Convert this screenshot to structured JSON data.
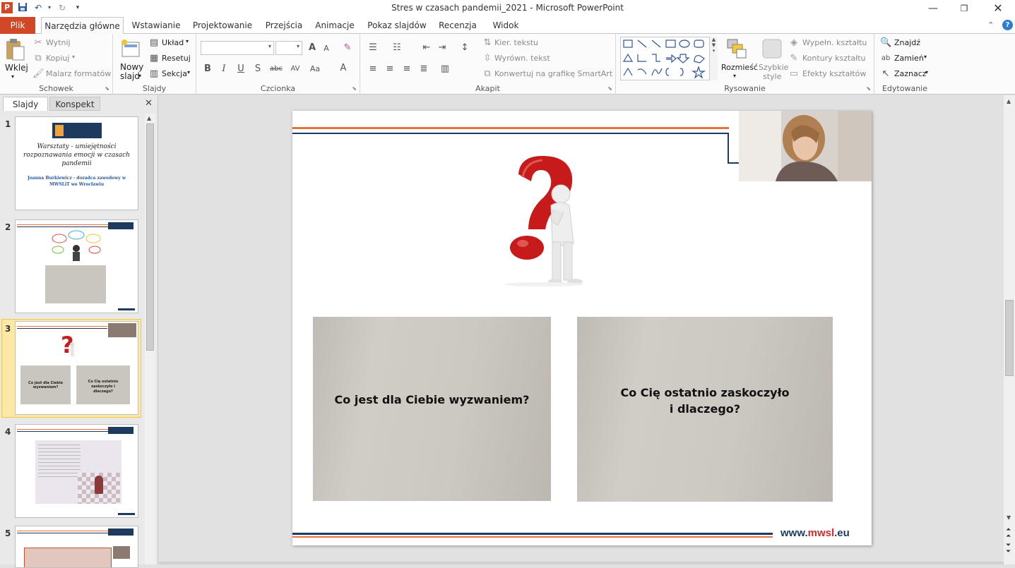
{
  "window": {
    "title": "Stres w czasach pandemii_2021  -  Microsoft PowerPoint"
  },
  "quick_access": [
    "save-icon",
    "undo-icon",
    "redo-icon",
    "customize-icon"
  ],
  "tabs": [
    {
      "label": "Plik"
    },
    {
      "label": "Narzędzia główne"
    },
    {
      "label": "Wstawianie"
    },
    {
      "label": "Projektowanie"
    },
    {
      "label": "Przejścia"
    },
    {
      "label": "Animacje"
    },
    {
      "label": "Pokaz slajdów"
    },
    {
      "label": "Recenzja"
    },
    {
      "label": "Widok"
    }
  ],
  "ribbon": {
    "clipboard": {
      "label": "Schowek",
      "paste": "Wklej",
      "cut": "Wytnij",
      "copy": "Kopiuj",
      "format_painter": "Malarz formatów"
    },
    "slides": {
      "label": "Slajdy",
      "new_slide_1": "Nowy",
      "new_slide_2": "slajd",
      "layout": "Układ",
      "reset": "Resetuj",
      "section": "Sekcja"
    },
    "font": {
      "label": "Czcionka"
    },
    "paragraph": {
      "label": "Akapit",
      "text_direction": "Kier. tekstu",
      "align_text": "Wyrówn. tekst",
      "smartart": "Konwertuj na grafikę SmartArt"
    },
    "drawing": {
      "label": "Rysowanie",
      "arrange": "Rozmieść",
      "quick_styles_1": "Szybkie",
      "quick_styles_2": "style",
      "shape_fill": "Wypełn. kształtu",
      "shape_outline": "Kontury kształtu",
      "shape_effects": "Efekty kształtów"
    },
    "editing": {
      "label": "Edytowanie",
      "find": "Znajdź",
      "replace": "Zamień",
      "select": "Zaznacz"
    }
  },
  "left_pane": {
    "tab_slides": "Slajdy",
    "tab_outline": "Konspekt",
    "thumbnails": [
      {
        "num": "1",
        "title": "Warsztaty - umiejętności rozpoznawania emocji w czasach pandemii",
        "author": "Joanna Burkiewicz - doradca zawodowy w MWSLiT we Wrocławiu"
      },
      {
        "num": "2"
      },
      {
        "num": "3",
        "card1": "Co jest dla Ciebie wyzwaniem?",
        "card2": "Co Cię ostatnio zaskoczyło i dlaczego?"
      },
      {
        "num": "4"
      },
      {
        "num": "5"
      }
    ]
  },
  "slide": {
    "card1": "Co jest dla Ciebie wyzwaniem?",
    "card2_line1": "Co Cię ostatnio zaskoczyło",
    "card2_line2": "i dlaczego?",
    "footer_www": "www.",
    "footer_brand": "mwsl",
    "footer_tld": ".eu"
  },
  "colors": {
    "file_tab": "#d24726",
    "slide_orange": "#e8703a",
    "slide_navy": "#1f3a5f",
    "brand_red": "#d42a2a",
    "thumb_selected": "#fde8a6"
  }
}
